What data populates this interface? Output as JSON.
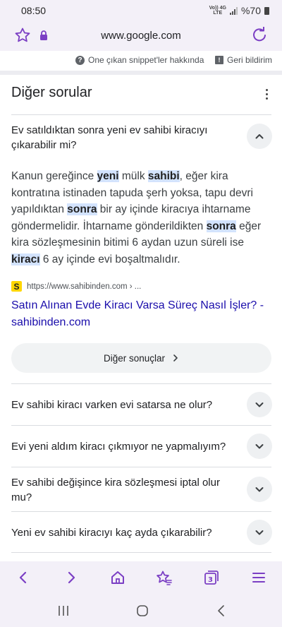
{
  "status_bar": {
    "time": "08:50",
    "network_top": "Vo)) 4G",
    "network_bottom": "LTE",
    "battery": "%70"
  },
  "address_bar": {
    "url": "www.google.com"
  },
  "snippet_bar": {
    "about_label": "One çıkan snippet'ler hakkında",
    "feedback_label": "Geri bildirim"
  },
  "section": {
    "title": "Diğer sorular"
  },
  "expanded_question": {
    "question": "Ev satıldıktan sonra yeni ev sahibi kiracıyı çıkarabilir mi?",
    "answer_parts": [
      {
        "text": "Kanun gereğince ",
        "hl": false
      },
      {
        "text": "yeni",
        "hl": true
      },
      {
        "text": " mülk ",
        "hl": false
      },
      {
        "text": "sahibi",
        "hl": true
      },
      {
        "text": ", eğer kira kontratına istinaden tapuda şerh yoksa, tapu devri yapıldıktan ",
        "hl": false
      },
      {
        "text": "sonra",
        "hl": true
      },
      {
        "text": " bir ay içinde kiracıya ihtarname göndermelidir. İhtarname gönderildikten ",
        "hl": false
      },
      {
        "text": "sonra",
        "hl": true
      },
      {
        "text": " eğer kira sözleşmesinin bitimi 6 aydan uzun süreli ise ",
        "hl": false
      },
      {
        "text": "kiracı",
        "hl": true
      },
      {
        "text": " 6 ay içinde evi boşaltmalıdır.",
        "hl": false
      }
    ],
    "source": {
      "favicon_letter": "S",
      "url": "https://www.sahibinden.com › ...",
      "title": "Satın Alınan Evde Kiracı Varsa Süreç Nasıl İşler? -",
      "site": "sahibinden.com"
    },
    "more_results_label": "Diğer sonuçlar"
  },
  "questions": [
    {
      "text": "Ev sahibi kiracı varken evi satarsa ne olur?"
    },
    {
      "text": "Evi yeni aldım kiracı çıkmıyor ne yapmalıyım?"
    },
    {
      "text": "Ev sahibi değişince kira sözleşmesi iptal olur mu?"
    },
    {
      "text": "Yeni ev sahibi kiracıyı kaç ayda çıkarabilir?"
    }
  ],
  "bottom_nav": {
    "tab_count": "3"
  },
  "colors": {
    "accent": "#7b3fc4",
    "link": "#1a0dab",
    "highlight": "#d3e3fd"
  }
}
